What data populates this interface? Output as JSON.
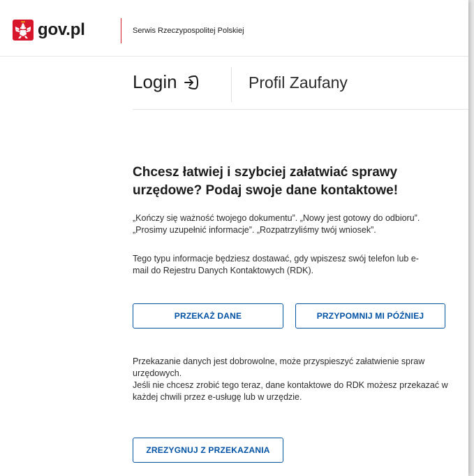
{
  "header": {
    "logo_text": "gov.pl",
    "service_name": "Serwis Rzeczypospolitej Polskiej"
  },
  "subheader": {
    "login_label": "Login",
    "profile_label": "Profil Zaufany"
  },
  "main": {
    "heading": "Chcesz łatwiej i szybciej załatwiać sprawy urzędowe? Podaj swoje dane kontaktowe!",
    "paragraph_1": "„Kończy się ważność twojego dokumentu”. „Nowy jest gotowy do odbioru”. „Prosimy uzupełnić informacje”. „Rozpatrzyliśmy twój wniosek”.",
    "paragraph_2": "Tego typu informacje będziesz dostawać, gdy wpiszesz swój telefon lub e-mail do Rejestru Danych Kontaktowych (RDK).",
    "provide_button": "PRZEKAŻ DANE",
    "remind_button": "PRZYPOMNIJ MI PÓŹNIEJ",
    "paragraph_3": "Przekazanie danych jest dobrowolne, może przyspieszyć załatwienie spraw urzędowych.",
    "paragraph_4": "Jeśli nie chcesz zrobić tego teraz, dane kontaktowe do RDK możesz przekazać w każdej chwili przez e-usługę lub w urzędzie.",
    "resign_button": "ZREZYGNUJ Z PRZEKAZANIA"
  },
  "colors": {
    "accent": "#0052a5",
    "brand_red": "#d7152b",
    "text": "#1b1b1b"
  },
  "icons": {
    "logo": "polish-eagle-emblem-icon",
    "login": "login-arrow-icon"
  }
}
